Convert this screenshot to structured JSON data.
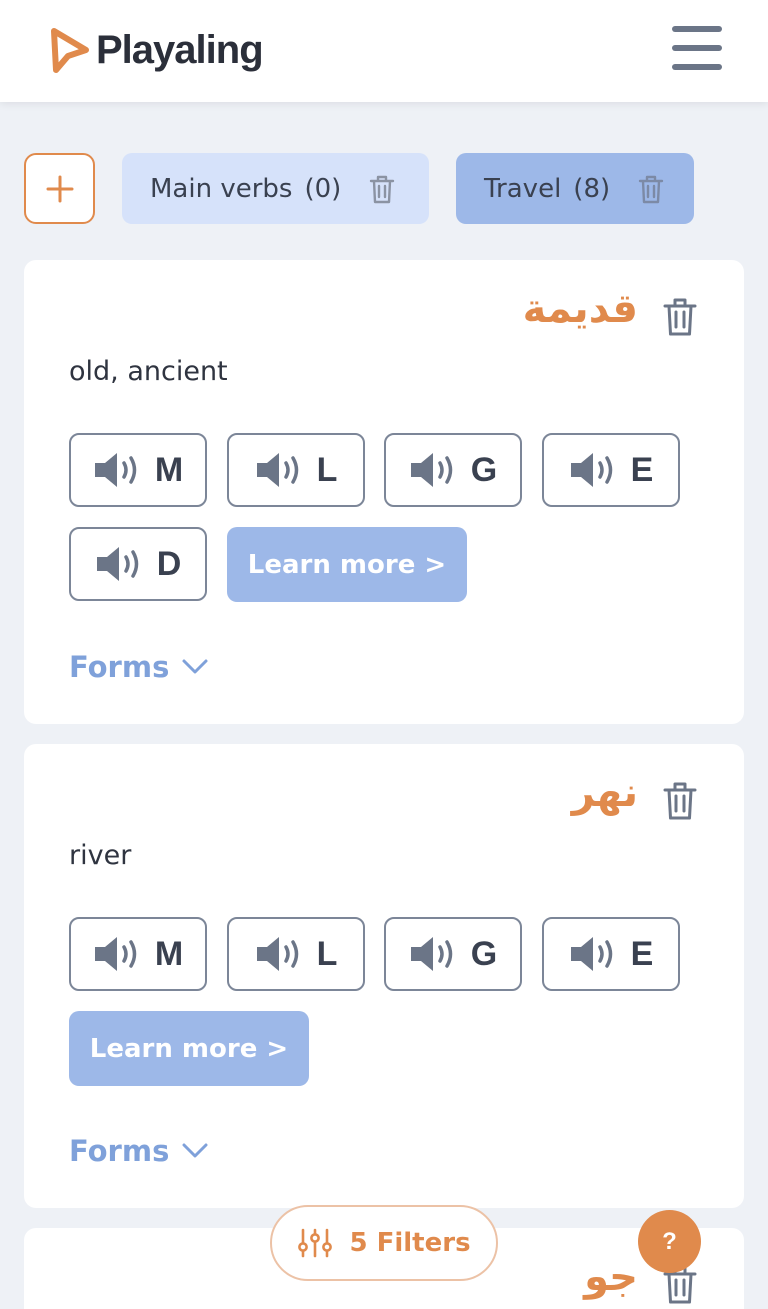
{
  "app": {
    "name": "Playaling"
  },
  "lists": [
    {
      "label": "Main verbs",
      "count": "(0)"
    },
    {
      "label": "Travel",
      "count": "(8)"
    }
  ],
  "audio_labels": [
    "M",
    "L",
    "G",
    "E",
    "D"
  ],
  "cards": [
    {
      "word": "قديمة",
      "translation": "old, ancient",
      "learn_more": "Learn more >",
      "forms": "Forms"
    },
    {
      "word": "نهر",
      "translation": "river",
      "learn_more": "Learn more >",
      "forms": "Forms"
    },
    {
      "word": "جو"
    }
  ],
  "filters": {
    "label": "5 Filters"
  },
  "help": {
    "label": "?"
  },
  "colors": {
    "accent": "#e08a4c",
    "tab_active": "#9db8e8",
    "tab_inactive": "#d6e2fa",
    "learn_button": "#9db8e8",
    "forms_link": "#7fa1da",
    "background": "#eef1f6"
  },
  "icons": [
    "logo-icon",
    "menu-icon",
    "plus-icon",
    "trash-icon",
    "speaker-icon",
    "chevron-down-icon",
    "sliders-icon"
  ]
}
